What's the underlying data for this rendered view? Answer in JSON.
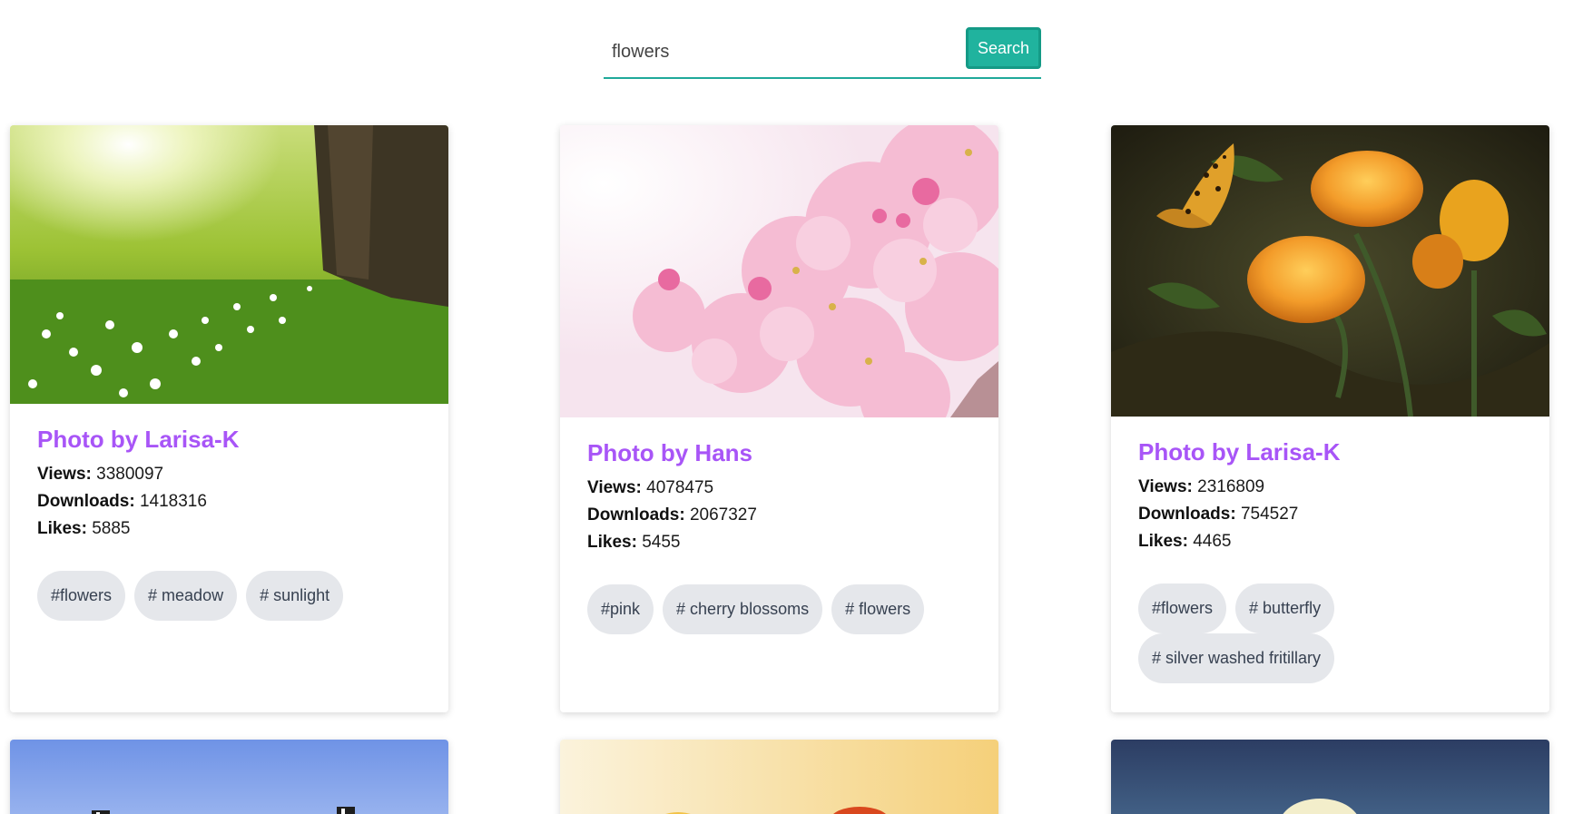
{
  "search": {
    "value": "flowers",
    "button_label": "Search"
  },
  "labels": {
    "views": "Views:",
    "downloads": "Downloads:",
    "likes": "Likes:"
  },
  "cards": [
    {
      "title": "Photo by Larisa-K",
      "views": "3380097",
      "downloads": "1418316",
      "likes": "5885",
      "tags": [
        "#flowers",
        "# meadow",
        "# sunlight"
      ],
      "image": "meadow with tree and white flowers in sunlight"
    },
    {
      "title": "Photo by Hans",
      "views": "4078475",
      "downloads": "2067327",
      "likes": "5455",
      "tags": [
        "#pink",
        "# cherry blossoms",
        "# flowers"
      ],
      "image": "pink cherry blossoms"
    },
    {
      "title": "Photo by Larisa-K",
      "views": "2316809",
      "downloads": "754527",
      "likes": "4465",
      "tags": [
        "#flowers",
        "# butterfly",
        "# silver washed fritillary"
      ],
      "image": "orange flowers with butterfly"
    }
  ],
  "colors": {
    "accent": "#20b39e",
    "title": "#a855f7",
    "tag_bg": "#e5e7eb"
  }
}
